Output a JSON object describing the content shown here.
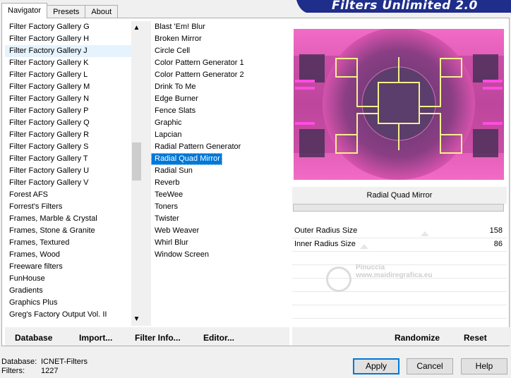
{
  "tabs": [
    {
      "label": "Navigator",
      "active": true
    },
    {
      "label": "Presets",
      "active": false
    },
    {
      "label": "About",
      "active": false
    }
  ],
  "banner": {
    "title": "Filters Unlimited 2.0",
    "color": "#1f2e8a"
  },
  "categories": [
    "Filter Factory Gallery G",
    "Filter Factory Gallery H",
    "Filter Factory Gallery J",
    "Filter Factory Gallery K",
    "Filter Factory Gallery L",
    "Filter Factory Gallery M",
    "Filter Factory Gallery N",
    "Filter Factory Gallery P",
    "Filter Factory Gallery Q",
    "Filter Factory Gallery R",
    "Filter Factory Gallery S",
    "Filter Factory Gallery T",
    "Filter Factory Gallery U",
    "Filter Factory Gallery V",
    "Forest AFS",
    "Forrest's Filters",
    "Frames, Marble & Crystal",
    "Frames, Stone & Granite",
    "Frames, Textured",
    "Frames, Wood",
    "Freeware filters",
    "FunHouse",
    "Gradients",
    "Graphics Plus",
    "Greg's Factory Output Vol. II"
  ],
  "category_selected_index": 2,
  "filters": [
    "Blast 'Em! Blur",
    "Broken Mirror",
    "Circle Cell",
    "Color Pattern Generator 1",
    "Color Pattern Generator 2",
    "Drink To Me",
    "Edge Burner",
    "Fence Slats",
    "Graphic",
    "Lapcian",
    "Radial Pattern Generator",
    "Radial Quad Mirror",
    "Radial Sun",
    "Reverb",
    "TeeWee",
    "Toners",
    "Twister",
    "Web Weaver",
    "Whirl Blur",
    "Window Screen"
  ],
  "filter_selected_index": 11,
  "toolbar": {
    "database": "Database",
    "import": "Import...",
    "filter_info": "Filter Info...",
    "editor": "Editor..."
  },
  "preview_toolbar": {
    "randomize": "Randomize",
    "reset": "Reset"
  },
  "current_filter": "Radial Quad Mirror",
  "params": [
    {
      "label": "Outer Radius Size",
      "value": "158"
    },
    {
      "label": "Inner Radius Size",
      "value": "86"
    }
  ],
  "watermark": {
    "line1": "Pinuccia",
    "line2": "www.maidiregrafica.eu"
  },
  "status": {
    "database_label": "Database:",
    "database_value": "ICNET-Filters",
    "filters_label": "Filters:",
    "filters_value": "1227"
  },
  "buttons": {
    "apply": "Apply",
    "cancel": "Cancel",
    "help": "Help"
  },
  "colors": {
    "selection": "#0078d7",
    "preview_pink": "#e64fb4",
    "preview_dark": "#4a3058",
    "preview_line": "#f5f08c"
  }
}
